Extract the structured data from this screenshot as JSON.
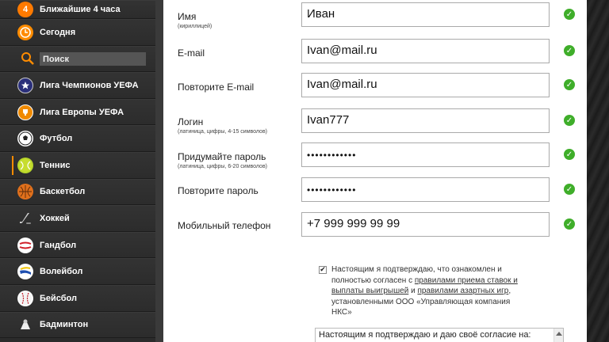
{
  "sidebar": {
    "items": [
      {
        "label": "Ближайшие 4 часа",
        "icon": "hours-4-icon",
        "badge": "4"
      },
      {
        "label": "Сегодня",
        "icon": "clock-icon"
      },
      {
        "label": "",
        "icon": "search-icon"
      },
      {
        "label": "Лига Чемпионов УЕФА",
        "icon": "champions-league-icon"
      },
      {
        "label": "Лига Европы УЕФА",
        "icon": "europa-league-icon"
      },
      {
        "label": "Футбол",
        "icon": "football-icon"
      },
      {
        "label": "Теннис",
        "icon": "tennis-icon"
      },
      {
        "label": "Баскетбол",
        "icon": "basketball-icon"
      },
      {
        "label": "Хоккей",
        "icon": "hockey-icon"
      },
      {
        "label": "Гандбол",
        "icon": "handball-icon"
      },
      {
        "label": "Волейбол",
        "icon": "volleyball-icon"
      },
      {
        "label": "Бейсбол",
        "icon": "baseball-icon"
      },
      {
        "label": "Бадминтон",
        "icon": "badminton-icon"
      }
    ],
    "search_placeholder": "Поиск",
    "active_index": 6,
    "accent": "#ff8c00"
  },
  "form": {
    "name": {
      "label": "Имя",
      "sub": "(кириллицей)",
      "value": "Иван"
    },
    "email": {
      "label": "E-mail",
      "value": "Ivan@mail.ru"
    },
    "email_repeat": {
      "label": "Повторите E-mail",
      "value": "Ivan@mail.ru"
    },
    "login": {
      "label": "Логин",
      "sub": "(латиница, цифры, 4-15 символов)",
      "value": "Ivan777"
    },
    "password": {
      "label": "Придумайте пароль",
      "sub": "(латиница, цифры, 6-20 символов)",
      "value": "••••••••••••"
    },
    "password_repeat": {
      "label": "Повторите пароль",
      "value": "••••••••••••"
    },
    "phone": {
      "label": "Мобильный телефон",
      "value": "+7 999 999 99 99"
    },
    "valid_color": "#3fae2a"
  },
  "consent": {
    "checked": true,
    "text_1": "Настоящим я подтверждаю, что ознакомлен и полностью согласен с",
    "link_1": "правилами приема ставок и выплаты выигрышей",
    "text_2": "и",
    "link_2": "правилами азартных игр",
    "text_3": ", установленными ООО «Управляющая компания НКС»"
  },
  "consent2": {
    "text": "Настоящим я подтверждаю и даю своё согласие на:"
  }
}
